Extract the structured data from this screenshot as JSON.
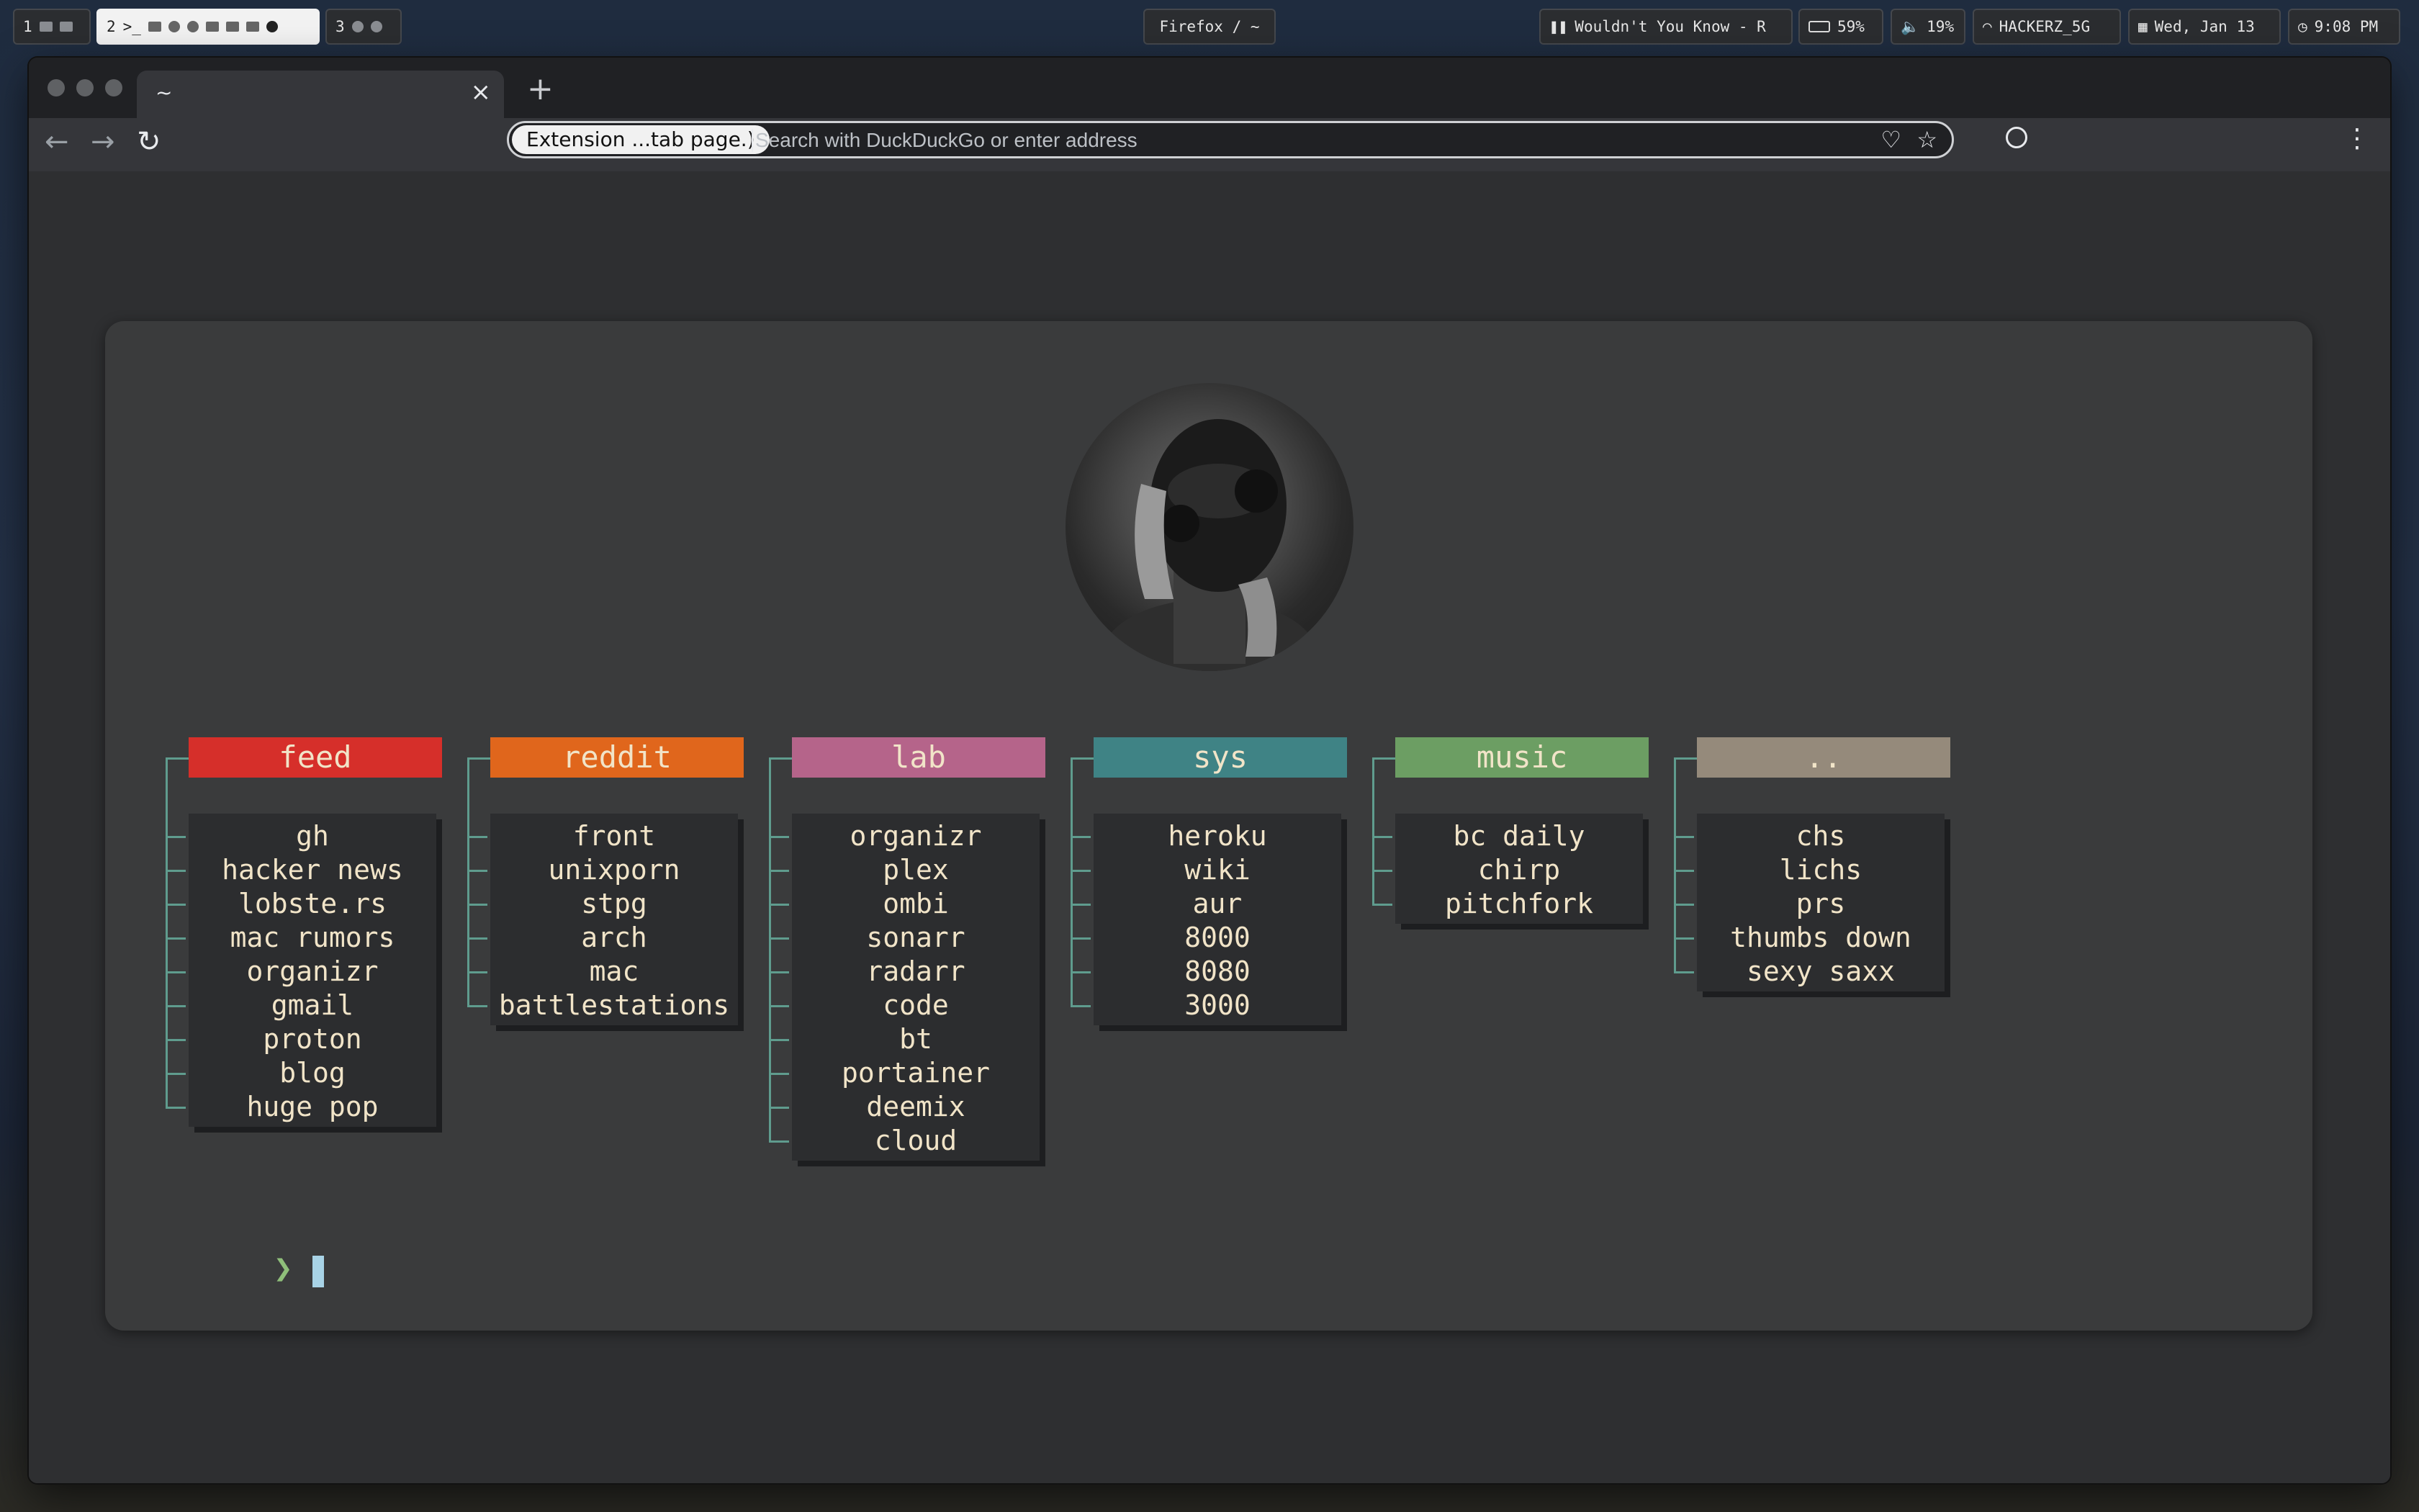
{
  "topbar": {
    "workspaces": [
      {
        "num": "1"
      },
      {
        "num": "2"
      },
      {
        "num": "3"
      }
    ],
    "window_title": "Firefox / ~",
    "now_playing": "Wouldn't You Know - R",
    "battery": "59%",
    "volume": "19%",
    "wifi": "HACKERZ_5G",
    "date": "Wed, Jan 13",
    "time": "9:08 PM"
  },
  "browser": {
    "tab_title": "~",
    "tab_close": "×",
    "new_tab": "+",
    "back": "←",
    "forward": "→",
    "reload": "↻",
    "extension_chip": "Extension ...tab page.)",
    "address_placeholder": "Search with DuckDuckGo or enter address",
    "address_value": "",
    "menu": "⋮"
  },
  "startpage": {
    "groups": [
      {
        "title": "feed",
        "color": "#d62f2a",
        "items": [
          "gh",
          "hacker news",
          "lobste.rs",
          "mac rumors",
          "organizr",
          "gmail",
          "proton",
          "blog",
          "huge pop"
        ]
      },
      {
        "title": "reddit",
        "color": "#e0661c",
        "items": [
          "front",
          "unixporn",
          "stpg",
          "arch",
          "mac",
          "battlestations"
        ]
      },
      {
        "title": "lab",
        "color": "#b5648a",
        "items": [
          "organizr",
          "plex",
          "ombi",
          "sonarr",
          "radarr",
          "code",
          "bt",
          "portainer",
          "deemix",
          "cloud"
        ]
      },
      {
        "title": "sys",
        "color": "#3f8385",
        "items": [
          "heroku",
          "wiki",
          "aur",
          "8000",
          "8080",
          "3000"
        ]
      },
      {
        "title": "music",
        "color": "#6c9e63",
        "items": [
          "bc daily",
          "chirp",
          "pitchfork"
        ]
      },
      {
        "title": "..",
        "color": "#958a7b",
        "items": [
          "chs",
          "lichs",
          "prs",
          "thumbs down",
          "sexy saxx"
        ]
      }
    ],
    "prompt": "❯"
  }
}
